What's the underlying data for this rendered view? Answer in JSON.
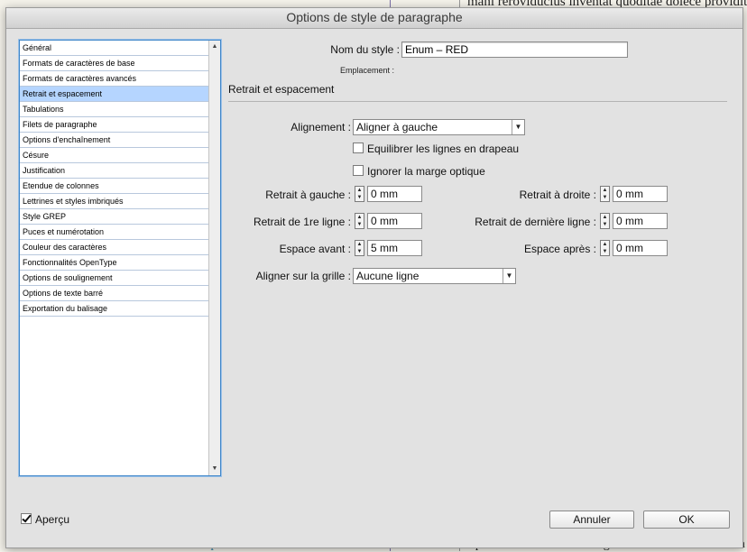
{
  "background": {
    "top_text": "mani reroviducius inventat quoditae dolece providitio",
    "bottom_text_left": "ium mir ero dolaut volor sitem vellu optatio. Solorious corum a volorer",
    "bottom_text_right": "reperrovid ut endae. Ad magnimens maximus molorum"
  },
  "dialog": {
    "title": "Options de style de paragraphe"
  },
  "categories": [
    {
      "label": "Général"
    },
    {
      "label": "Formats de caractères de base"
    },
    {
      "label": "Formats de caractères avancés"
    },
    {
      "label": "Retrait et espacement"
    },
    {
      "label": "Tabulations"
    },
    {
      "label": "Filets de paragraphe"
    },
    {
      "label": "Options d'enchaînement"
    },
    {
      "label": "Césure"
    },
    {
      "label": "Justification"
    },
    {
      "label": "Etendue de colonnes"
    },
    {
      "label": "Lettrines et styles imbriqués"
    },
    {
      "label": "Style GREP"
    },
    {
      "label": "Puces et numérotation"
    },
    {
      "label": "Couleur des caractères"
    },
    {
      "label": "Fonctionnalités OpenType"
    },
    {
      "label": "Options de soulignement"
    },
    {
      "label": "Options de texte barré"
    },
    {
      "label": "Exportation du balisage"
    }
  ],
  "selected_category": "Retrait et espacement",
  "style_name": {
    "label": "Nom du style :",
    "value": "Enum – RED"
  },
  "location": {
    "label": "Emplacement :"
  },
  "section": {
    "title": "Retrait et espacement"
  },
  "alignment": {
    "label": "Alignement :",
    "value": "Aligner à gauche"
  },
  "checkboxes": {
    "balance": {
      "label": "Equilibrer les lignes en drapeau",
      "checked": false
    },
    "optical": {
      "label": "Ignorer la marge optique",
      "checked": false
    }
  },
  "fields": {
    "left_indent": {
      "label": "Retrait à gauche :",
      "value": "0 mm"
    },
    "right_indent": {
      "label": "Retrait à droite :",
      "value": "0 mm"
    },
    "first_line": {
      "label": "Retrait de 1re ligne :",
      "value": "0 mm"
    },
    "last_line": {
      "label": "Retrait de dernière ligne :",
      "value": "0 mm"
    },
    "space_before": {
      "label": "Espace avant :",
      "value": "5 mm"
    },
    "space_after": {
      "label": "Espace après :",
      "value": "0 mm"
    }
  },
  "grid": {
    "label": "Aligner sur la grille :",
    "value": "Aucune ligne"
  },
  "footer": {
    "preview_label": "Aperçu",
    "preview_checked": true,
    "cancel_label": "Annuler",
    "ok_label": "OK"
  },
  "icons": {
    "up": "▲",
    "down": "▼",
    "dropdown": "▼"
  }
}
